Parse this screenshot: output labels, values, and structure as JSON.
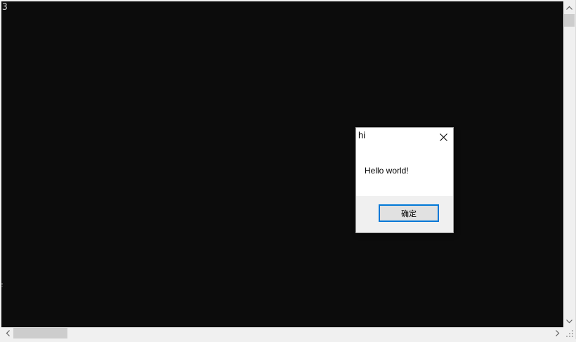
{
  "console": {
    "text": "3",
    "edge_glyph": "≡"
  },
  "dialog": {
    "title": "hi",
    "message": "Hello world!",
    "ok_label": "确定",
    "close_icon": "close-icon"
  },
  "scrollbars": {
    "vertical_icons": [
      "chevron-up-icon",
      "chevron-down-icon"
    ],
    "horizontal_icons": [
      "chevron-left-icon",
      "chevron-right-icon"
    ]
  },
  "colors": {
    "console_background": "#0c0c0c",
    "console_text": "#cccccc",
    "dialog_background": "#ffffff",
    "dialog_footer": "#f0f0f0",
    "button_focus_border": "#0078d7"
  }
}
